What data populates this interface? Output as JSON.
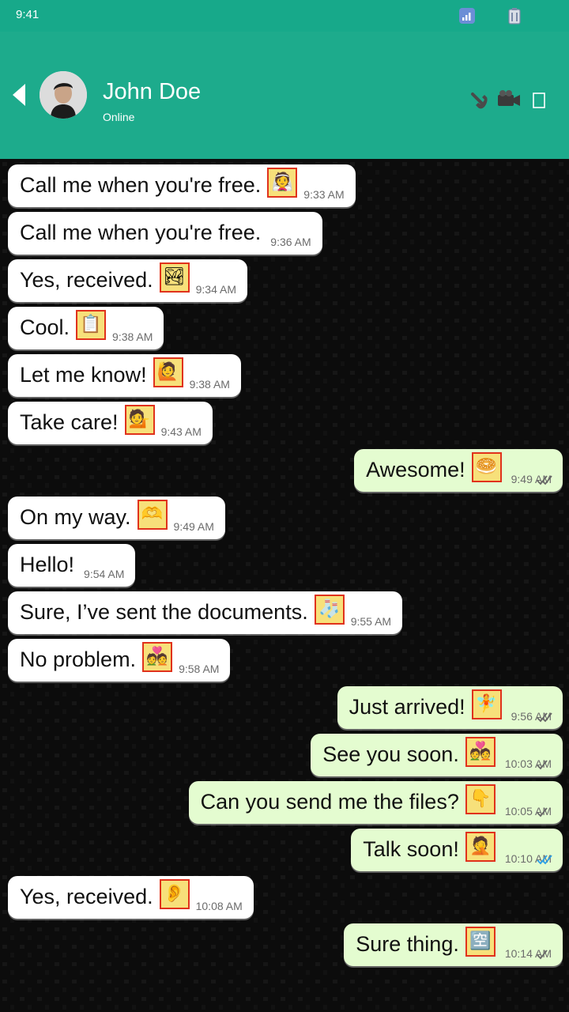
{
  "status_bar": {
    "time": "9:41"
  },
  "header": {
    "name": "John Doe",
    "status": "Online",
    "icons": [
      "back-arrow-icon",
      "phone-icon",
      "video-camera-icon",
      "more-options-icon"
    ]
  },
  "colors": {
    "header": "#1dab8c",
    "status_bar": "#17a98a",
    "incoming_bubble": "#ffffff",
    "outgoing_bubble": "#e4fcd0",
    "tick_read": "#2aa0e8",
    "tick_sent": "#666666"
  },
  "messages": [
    {
      "direction": "in",
      "text": "Call me when you're free.",
      "emoji": "woman-with-veil",
      "time": "9:33 AM"
    },
    {
      "direction": "in",
      "text": "Call me when you're free.",
      "time": "9:36 AM"
    },
    {
      "direction": "in",
      "text": "Yes, received.",
      "emoji": "national-park",
      "time": "9:34 AM"
    },
    {
      "direction": "in",
      "text": "Cool.",
      "emoji": "clipboard",
      "time": "9:38 AM"
    },
    {
      "direction": "in",
      "text": "Let me know!",
      "emoji": "person-raising-hand",
      "time": "9:38 AM"
    },
    {
      "direction": "in",
      "text": "Take care!",
      "emoji": "person-tipping-hand",
      "time": "9:43 AM"
    },
    {
      "direction": "out",
      "text": "Awesome!",
      "emoji": "bagel",
      "time": "9:49 AM",
      "ticks": "double"
    },
    {
      "direction": "in",
      "text": "On my way.",
      "emoji": "heart-hands",
      "time": "9:49 AM"
    },
    {
      "direction": "in",
      "text": "Hello!",
      "time": "9:54 AM"
    },
    {
      "direction": "in",
      "text": "Sure, I’ve sent the documents.",
      "emoji": "socks",
      "time": "9:55 AM"
    },
    {
      "direction": "in",
      "text": "No problem.",
      "emoji": "couple-with-heart",
      "time": "9:58 AM"
    },
    {
      "direction": "out",
      "text": "Just arrived!",
      "emoji": "fairy",
      "time": "9:56 AM",
      "ticks": "double"
    },
    {
      "direction": "out",
      "text": "See you soon.",
      "emoji": "couple-with-heart",
      "time": "10:03 AM",
      "ticks": "single"
    },
    {
      "direction": "out",
      "text": "Can you send me the files?",
      "emoji": "backhand-index-pointing-down",
      "time": "10:05 AM",
      "ticks": "single"
    },
    {
      "direction": "out",
      "text": "Talk soon!",
      "emoji": "person-facepalming",
      "time": "10:10 AM",
      "ticks": "read"
    },
    {
      "direction": "in",
      "text": "Yes, received.",
      "emoji": "ear",
      "time": "10:08 AM"
    },
    {
      "direction": "out",
      "text": "Sure thing.",
      "emoji": "japanese-vacancy-button",
      "time": "10:14 AM",
      "ticks": "single"
    }
  ]
}
